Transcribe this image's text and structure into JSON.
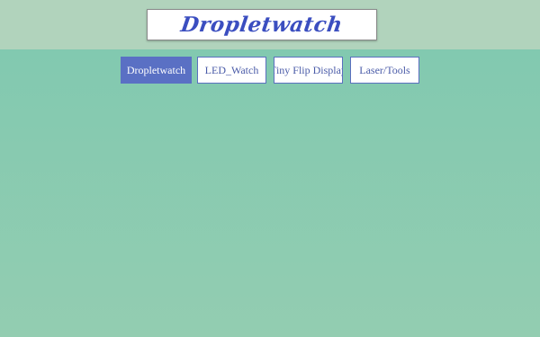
{
  "header": {
    "logo_text": "Dropletwatch"
  },
  "nav": {
    "tabs": [
      {
        "label": "Dropletwatch",
        "active": true
      },
      {
        "label": "LED_Watch",
        "active": false
      },
      {
        "label": "Tiny Flip Display",
        "active": false
      },
      {
        "label": "Laser/Tools",
        "active": false
      }
    ]
  },
  "colors": {
    "accent": "#5a70c4",
    "logo": "#3b4ec0",
    "header_band": "#b1d3bc",
    "background": "#7fc8b0"
  }
}
